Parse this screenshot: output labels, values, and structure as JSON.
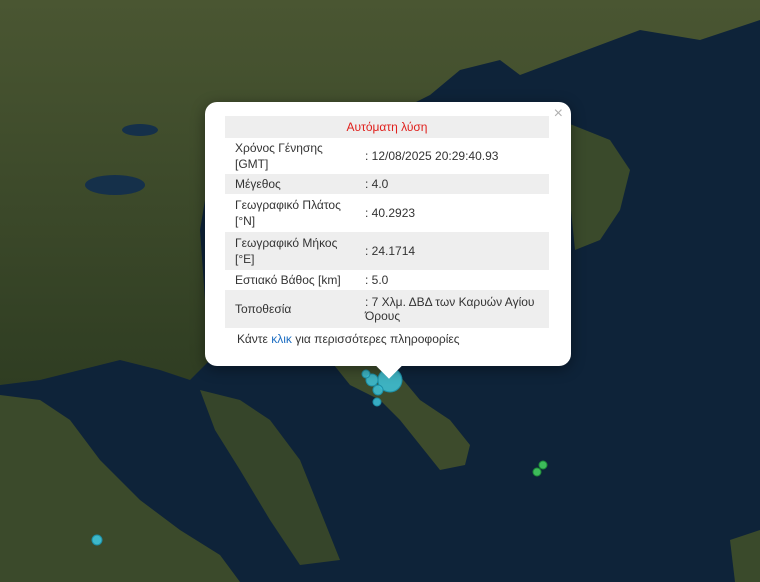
{
  "popup": {
    "title": "Αυτόματη λύση",
    "close_label": "×",
    "rows": [
      {
        "label": "Χρόνος Γένησης [GMT]",
        "value": ": 12/08/2025 20:29:40.93"
      },
      {
        "label": "Μέγεθος",
        "value": ": 4.0"
      },
      {
        "label": "Γεωγραφικό Πλάτος [°N]",
        "value": ": 40.2923"
      },
      {
        "label": "Γεωγραφικό Μήκος [°E]",
        "value": ": 24.1714"
      },
      {
        "label": "Εστιακό Βάθος [km]",
        "value": ": 5.0"
      },
      {
        "label": "Τοποθεσία",
        "value": ": 7 Χλμ. ΔΒΔ των Καρυών Αγίου Όρους"
      }
    ],
    "more_prefix": "Κάντε ",
    "more_link": "κλικ",
    "more_suffix": " για περισσότερες πληροφορίες"
  },
  "colors": {
    "sea": "#0d2238",
    "land": "#3b4a2a",
    "quake_cyan": "#3ec4dc",
    "quake_green": "#3dbb5a",
    "title_red": "#e0201c",
    "link_blue": "#1f6fc2"
  }
}
